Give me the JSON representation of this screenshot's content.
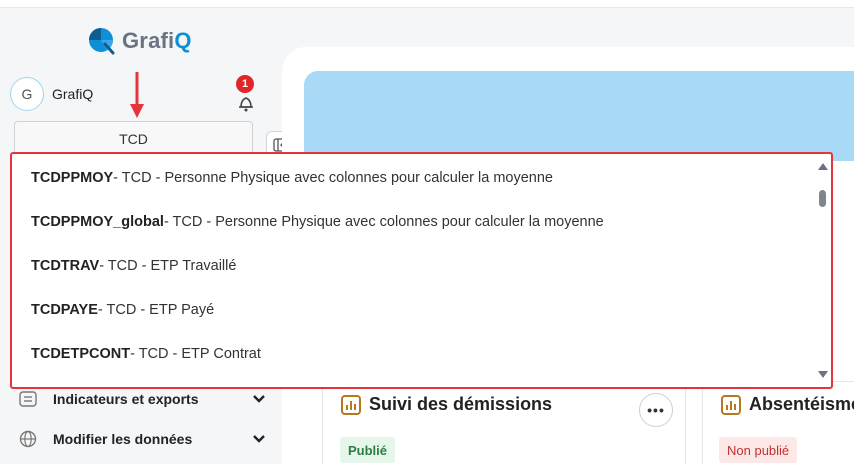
{
  "app": {
    "logo_text": "Grafi",
    "logo_text_q": "Q"
  },
  "user": {
    "initial": "G",
    "name": "GrafiQ"
  },
  "notifications": {
    "count": "1"
  },
  "selector": {
    "value": "TCD",
    "options": [
      {
        "code": "TCDPPMOY",
        "desc": " - TCD - Personne Physique avec colonnes pour calculer la moyenne"
      },
      {
        "code": "TCDPPMOY_global",
        "desc": " - TCD - Personne Physique avec colonnes pour calculer la moyenne"
      },
      {
        "code": "TCDTRAV",
        "desc": " - TCD - ETP Travaillé"
      },
      {
        "code": "TCDPAYE",
        "desc": " - TCD - ETP Payé"
      },
      {
        "code": "TCDETPCONT",
        "desc": " - TCD - ETP Contrat"
      }
    ],
    "scroll_fraction": 0.0
  },
  "sidebar": {
    "items": [
      {
        "label": "Indicateurs et exports",
        "icon": "list-icon"
      },
      {
        "label": "Modifier les données",
        "icon": "globe-icon"
      }
    ]
  },
  "cards": [
    {
      "title": "Suivi des démissions",
      "status": "Publié",
      "more": "•••"
    },
    {
      "title": "Absentéisme",
      "status": "Non publié"
    }
  ],
  "colors": {
    "accent": "#0f8fd8",
    "highlight": "#e5343b",
    "banner": "#a8daf7",
    "published": "#2f7d43",
    "unpublished": "#c53030"
  }
}
